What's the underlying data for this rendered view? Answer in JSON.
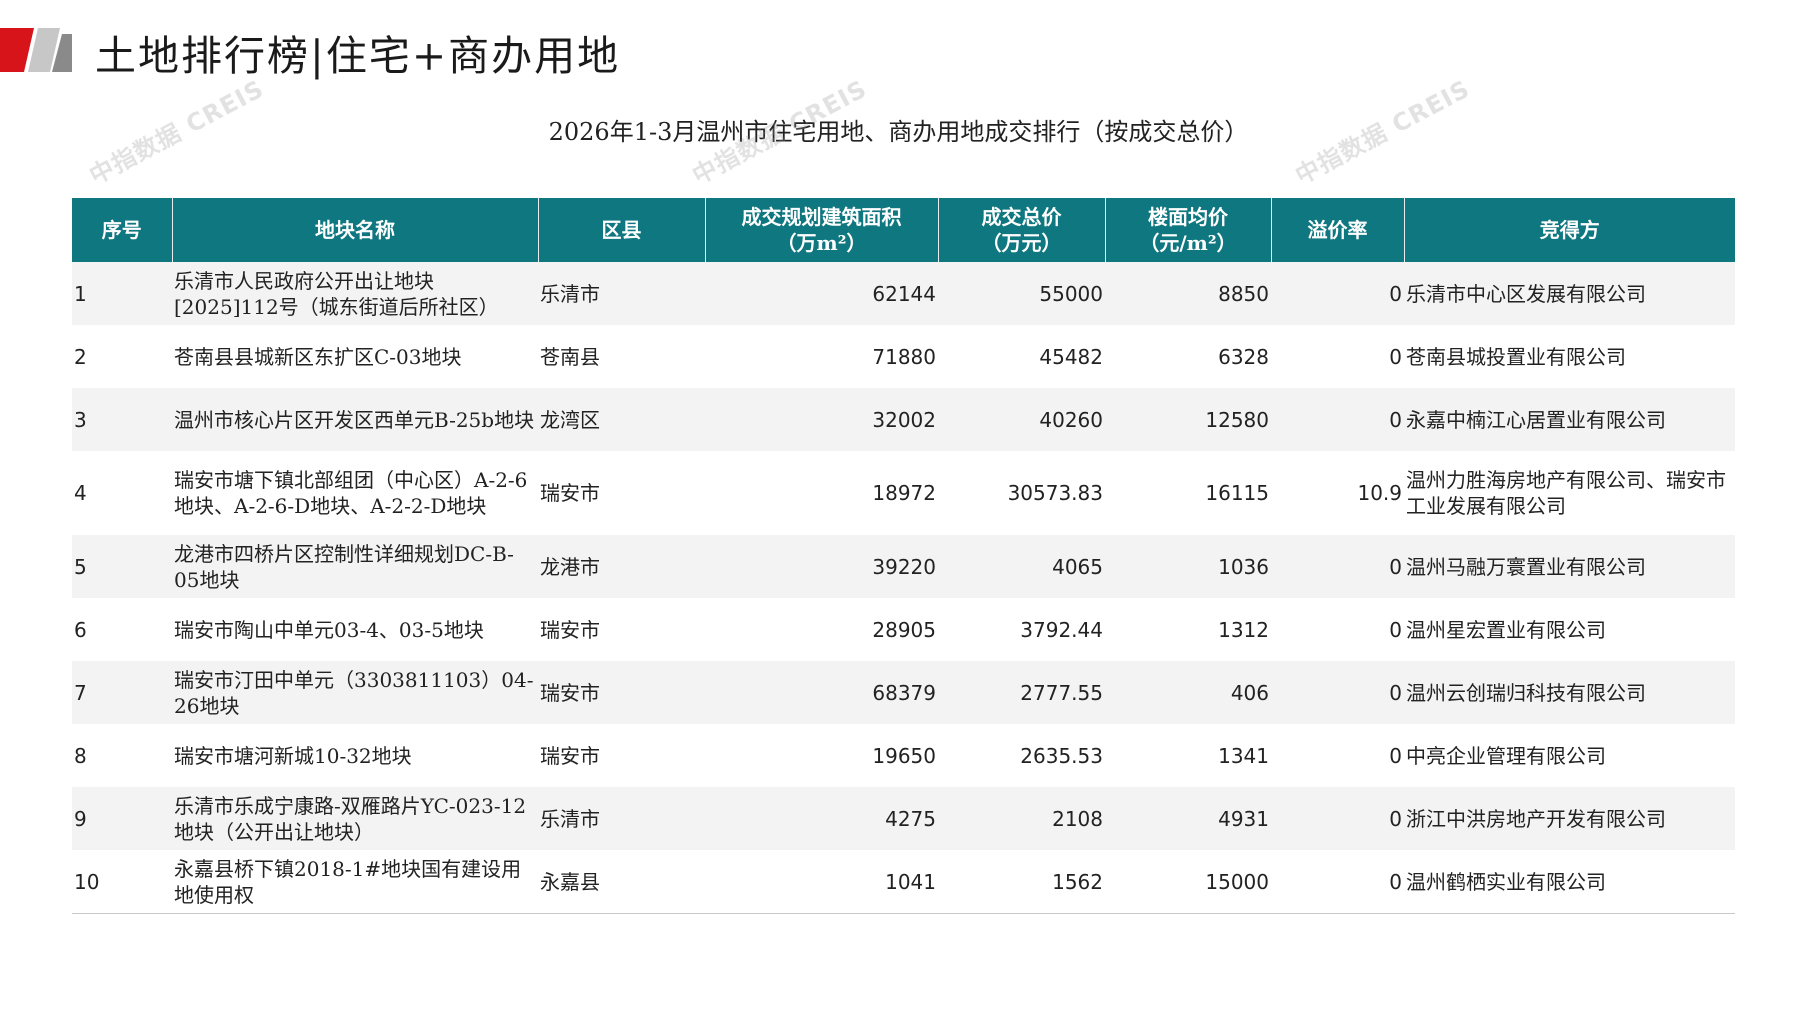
{
  "header": {
    "title": "土地排行榜|住宅+商办用地"
  },
  "table_title": "2026年1-3月温州市住宅用地、商办用地成交排行（按成交总价）",
  "watermark": "中指数据 CREIS",
  "colors": {
    "header_bg": "#0f7780",
    "accent_red": "#c8102e",
    "row_alt": "#f3f3f3"
  },
  "columns": [
    {
      "line1": "序号",
      "line2": ""
    },
    {
      "line1": "地块名称",
      "line2": ""
    },
    {
      "line1": "区县",
      "line2": ""
    },
    {
      "line1": "成交规划建筑面积",
      "line2": "（万m²）"
    },
    {
      "line1": "成交总价",
      "line2": "（万元）"
    },
    {
      "line1": "楼面均价",
      "line2": "（元/m²）"
    },
    {
      "line1": "溢价率",
      "line2": ""
    },
    {
      "line1": "竞得方",
      "line2": ""
    }
  ],
  "rows": [
    {
      "seq": "1",
      "name": "乐清市人民政府公开出让地块[2025]112号（城东街道后所社区）",
      "district": "乐清市",
      "area": "62144",
      "total": "55000",
      "unit_price": "8850",
      "premium": "0",
      "winner": "乐清市中心区发展有限公司"
    },
    {
      "seq": "2",
      "name": "苍南县县城新区东扩区C-03地块",
      "district": "苍南县",
      "area": "71880",
      "total": "45482",
      "unit_price": "6328",
      "premium": "0",
      "winner": "苍南县城投置业有限公司"
    },
    {
      "seq": "3",
      "name": "温州市核心片区开发区西单元B-25b地块",
      "district": "龙湾区",
      "area": "32002",
      "total": "40260",
      "unit_price": "12580",
      "premium": "0",
      "winner": "永嘉中楠江心居置业有限公司"
    },
    {
      "seq": "4",
      "name": "瑞安市塘下镇北部组团（中心区）A-2-6地块、A-2-6-D地块、A-2-2-D地块",
      "district": "瑞安市",
      "area": "18972",
      "total": "30573.83",
      "unit_price": "16115",
      "premium": "10.9",
      "winner": "温州力胜海房地产有限公司、瑞安市工业发展有限公司"
    },
    {
      "seq": "5",
      "name": "龙港市四桥片区控制性详细规划DC-B-05地块",
      "district": "龙港市",
      "area": "39220",
      "total": "4065",
      "unit_price": "1036",
      "premium": "0",
      "winner": "温州马融万寰置业有限公司"
    },
    {
      "seq": "6",
      "name": "瑞安市陶山中单元03-4、03-5地块",
      "district": "瑞安市",
      "area": "28905",
      "total": "3792.44",
      "unit_price": "1312",
      "premium": "0",
      "winner": "温州星宏置业有限公司"
    },
    {
      "seq": "7",
      "name": "瑞安市汀田中单元（3303811103）04-26地块",
      "district": "瑞安市",
      "area": "68379",
      "total": "2777.55",
      "unit_price": "406",
      "premium": "0",
      "winner": "温州云创瑞归科技有限公司"
    },
    {
      "seq": "8",
      "name": "瑞安市塘河新城10-32地块",
      "district": "瑞安市",
      "area": "19650",
      "total": "2635.53",
      "unit_price": "1341",
      "premium": "0",
      "winner": "中亮企业管理有限公司"
    },
    {
      "seq": "9",
      "name": "乐清市乐成宁康路-双雁路片YC-023-12地块（公开出让地块）",
      "district": "乐清市",
      "area": "4275",
      "total": "2108",
      "unit_price": "4931",
      "premium": "0",
      "winner": "浙江中洪房地产开发有限公司"
    },
    {
      "seq": "10",
      "name": "永嘉县桥下镇2018-1#地块国有建设用地使用权",
      "district": "永嘉县",
      "area": "1041",
      "total": "1562",
      "unit_price": "15000",
      "premium": "0",
      "winner": "温州鹤栖实业有限公司"
    }
  ]
}
